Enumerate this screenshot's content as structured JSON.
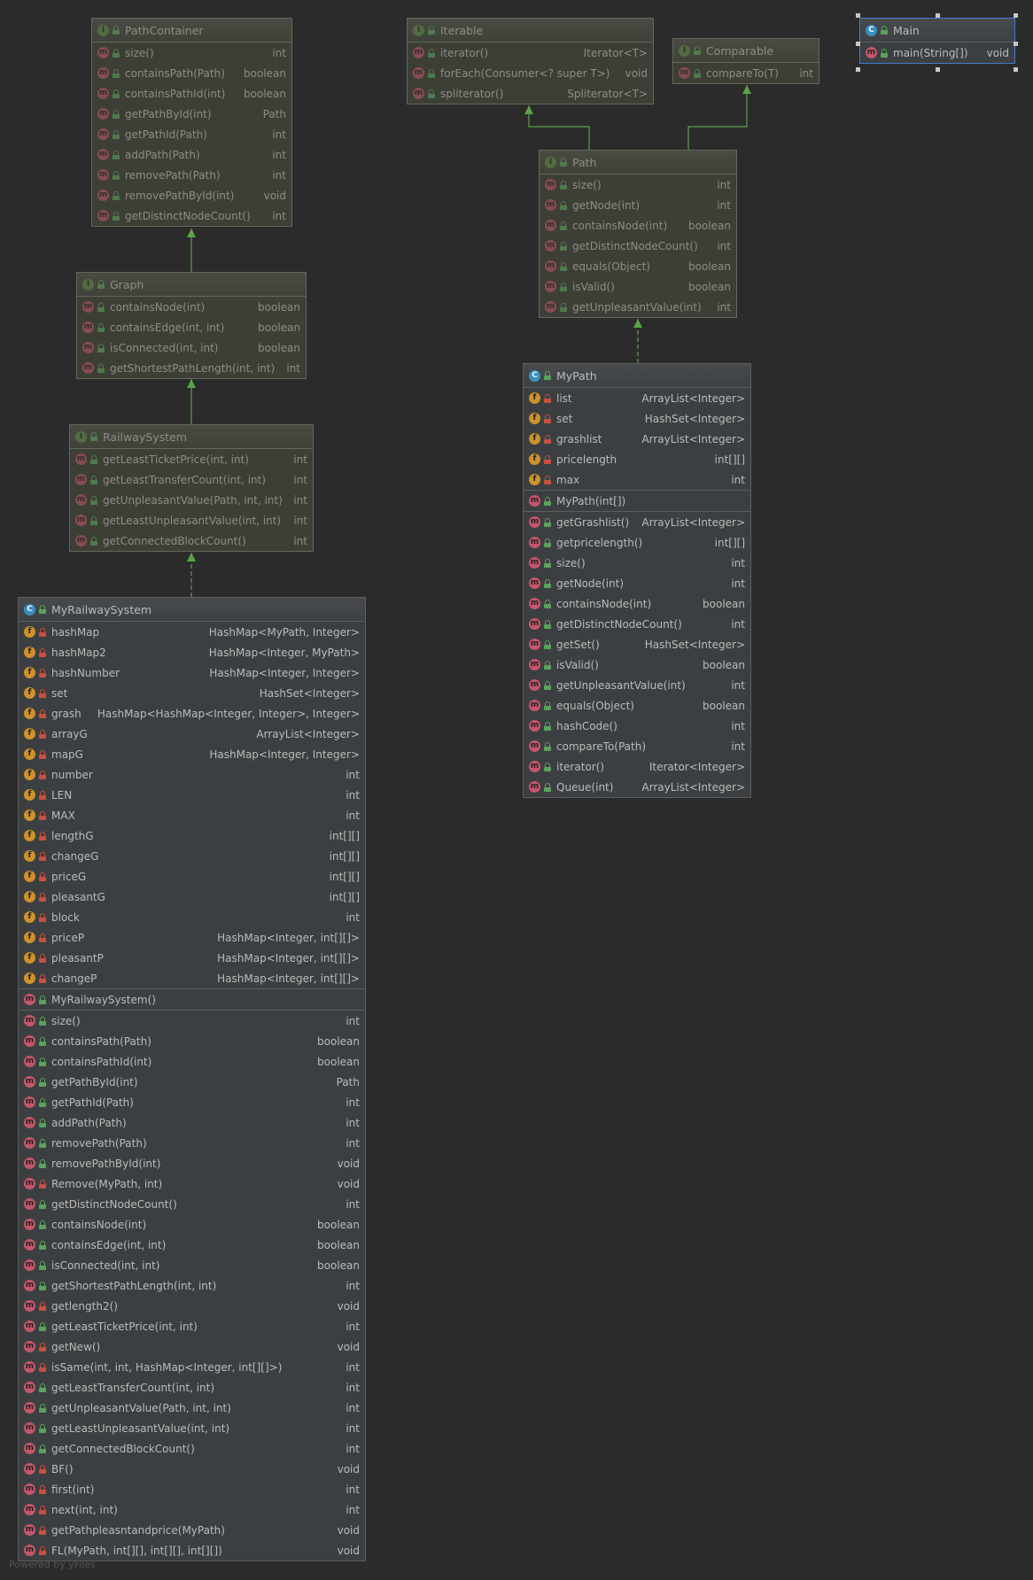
{
  "footer": "Powered by yFiles",
  "boxes": {
    "PathContainer": {
      "title": "PathContainer",
      "icon": "I",
      "methods": [
        {
          "name": "size()",
          "type": "int",
          "vis": "pub"
        },
        {
          "name": "containsPath(Path)",
          "type": "boolean",
          "vis": "pub"
        },
        {
          "name": "containsPathId(int)",
          "type": "boolean",
          "vis": "pub"
        },
        {
          "name": "getPathById(int)",
          "type": "Path",
          "vis": "pub"
        },
        {
          "name": "getPathId(Path)",
          "type": "int",
          "vis": "pub"
        },
        {
          "name": "addPath(Path)",
          "type": "int",
          "vis": "pub"
        },
        {
          "name": "removePath(Path)",
          "type": "int",
          "vis": "pub"
        },
        {
          "name": "removePathById(int)",
          "type": "void",
          "vis": "pub"
        },
        {
          "name": "getDistinctNodeCount()",
          "type": "int",
          "vis": "pub"
        }
      ]
    },
    "Graph": {
      "title": "Graph",
      "icon": "I",
      "methods": [
        {
          "name": "containsNode(int)",
          "type": "boolean",
          "vis": "pub"
        },
        {
          "name": "containsEdge(int, int)",
          "type": "boolean",
          "vis": "pub"
        },
        {
          "name": "isConnected(int, int)",
          "type": "boolean",
          "vis": "pub"
        },
        {
          "name": "getShortestPathLength(int, int)",
          "type": "int",
          "vis": "pub"
        }
      ]
    },
    "RailwaySystem": {
      "title": "RailwaySystem",
      "icon": "I",
      "methods": [
        {
          "name": "getLeastTicketPrice(int, int)",
          "type": "int",
          "vis": "pub"
        },
        {
          "name": "getLeastTransferCount(int, int)",
          "type": "int",
          "vis": "pub"
        },
        {
          "name": "getUnpleasantValue(Path, int, int)",
          "type": "int",
          "vis": "pub"
        },
        {
          "name": "getLeastUnpleasantValue(int, int)",
          "type": "int",
          "vis": "pub"
        },
        {
          "name": "getConnectedBlockCount()",
          "type": "int",
          "vis": "pub"
        }
      ]
    },
    "Iterable": {
      "title": "Iterable",
      "icon": "I",
      "methods": [
        {
          "name": "iterator()",
          "type": "Iterator<T>",
          "vis": "pub"
        },
        {
          "name": "forEach(Consumer<? super T>)",
          "type": "void",
          "vis": "pub"
        },
        {
          "name": "spliterator()",
          "type": "Spliterator<T>",
          "vis": "pub"
        }
      ]
    },
    "Comparable": {
      "title": "Comparable",
      "icon": "I",
      "methods": [
        {
          "name": "compareTo(T)",
          "type": "int",
          "vis": "pub"
        }
      ]
    },
    "Main": {
      "title": "Main",
      "icon": "C",
      "methods": [
        {
          "name": "main(String[])",
          "type": "void",
          "vis": "pub"
        }
      ]
    },
    "Path": {
      "title": "Path",
      "icon": "I",
      "methods": [
        {
          "name": "size()",
          "type": "int",
          "vis": "pub"
        },
        {
          "name": "getNode(int)",
          "type": "int",
          "vis": "pub"
        },
        {
          "name": "containsNode(int)",
          "type": "boolean",
          "vis": "pub"
        },
        {
          "name": "getDistinctNodeCount()",
          "type": "int",
          "vis": "pub"
        },
        {
          "name": "equals(Object)",
          "type": "boolean",
          "vis": "pub"
        },
        {
          "name": "isValid()",
          "type": "boolean",
          "vis": "pub"
        },
        {
          "name": "getUnpleasantValue(int)",
          "type": "int",
          "vis": "pub"
        }
      ]
    },
    "MyPath": {
      "title": "MyPath",
      "icon": "C",
      "fields": [
        {
          "name": "list",
          "type": "ArrayList<Integer>",
          "vis": "priv"
        },
        {
          "name": "set",
          "type": "HashSet<Integer>",
          "vis": "priv"
        },
        {
          "name": "grashlist",
          "type": "ArrayList<Integer>",
          "vis": "priv"
        },
        {
          "name": "pricelength",
          "type": "int[][]",
          "vis": "priv"
        },
        {
          "name": "max",
          "type": "int",
          "vis": "priv"
        }
      ],
      "constructors": [
        {
          "name": "MyPath(int[])",
          "type": "",
          "vis": "pub"
        }
      ],
      "methods": [
        {
          "name": "getGrashlist()",
          "type": "ArrayList<Integer>",
          "vis": "pub"
        },
        {
          "name": "getpricelength()",
          "type": "int[][]",
          "vis": "pub"
        },
        {
          "name": "size()",
          "type": "int",
          "vis": "pub"
        },
        {
          "name": "getNode(int)",
          "type": "int",
          "vis": "pub"
        },
        {
          "name": "containsNode(int)",
          "type": "boolean",
          "vis": "pub"
        },
        {
          "name": "getDistinctNodeCount()",
          "type": "int",
          "vis": "pub"
        },
        {
          "name": "getSet()",
          "type": "HashSet<Integer>",
          "vis": "pub"
        },
        {
          "name": "isValid()",
          "type": "boolean",
          "vis": "pub"
        },
        {
          "name": "getUnpleasantValue(int)",
          "type": "int",
          "vis": "pub"
        },
        {
          "name": "equals(Object)",
          "type": "boolean",
          "vis": "pub"
        },
        {
          "name": "hashCode()",
          "type": "int",
          "vis": "pub"
        },
        {
          "name": "compareTo(Path)",
          "type": "int",
          "vis": "pub"
        },
        {
          "name": "iterator()",
          "type": "Iterator<Integer>",
          "vis": "pub"
        },
        {
          "name": "Queue(int)",
          "type": "ArrayList<Integer>",
          "vis": "pub"
        }
      ]
    },
    "MyRailwaySystem": {
      "title": "MyRailwaySystem",
      "icon": "C",
      "fields": [
        {
          "name": "hashMap",
          "type": "HashMap<MyPath, Integer>",
          "vis": "priv"
        },
        {
          "name": "hashMap2",
          "type": "HashMap<Integer, MyPath>",
          "vis": "priv"
        },
        {
          "name": "hashNumber",
          "type": "HashMap<Integer, Integer>",
          "vis": "priv"
        },
        {
          "name": "set",
          "type": "HashSet<Integer>",
          "vis": "priv"
        },
        {
          "name": "grash",
          "type": "HashMap<HashMap<Integer, Integer>, Integer>",
          "vis": "priv"
        },
        {
          "name": "arrayG",
          "type": "ArrayList<Integer>",
          "vis": "priv"
        },
        {
          "name": "mapG",
          "type": "HashMap<Integer, Integer>",
          "vis": "priv"
        },
        {
          "name": "number",
          "type": "int",
          "vis": "priv"
        },
        {
          "name": "LEN",
          "type": "int",
          "vis": "priv"
        },
        {
          "name": "MAX",
          "type": "int",
          "vis": "priv"
        },
        {
          "name": "lengthG",
          "type": "int[][]",
          "vis": "priv"
        },
        {
          "name": "changeG",
          "type": "int[][]",
          "vis": "priv"
        },
        {
          "name": "priceG",
          "type": "int[][]",
          "vis": "priv"
        },
        {
          "name": "pleasantG",
          "type": "int[][]",
          "vis": "priv"
        },
        {
          "name": "block",
          "type": "int",
          "vis": "priv"
        },
        {
          "name": "priceP",
          "type": "HashMap<Integer, int[][]>",
          "vis": "priv"
        },
        {
          "name": "pleasantP",
          "type": "HashMap<Integer, int[][]>",
          "vis": "priv"
        },
        {
          "name": "changeP",
          "type": "HashMap<Integer, int[][]>",
          "vis": "priv"
        }
      ],
      "constructors": [
        {
          "name": "MyRailwaySystem()",
          "type": "",
          "vis": "pub"
        }
      ],
      "methods": [
        {
          "name": "size()",
          "type": "int",
          "vis": "pub"
        },
        {
          "name": "containsPath(Path)",
          "type": "boolean",
          "vis": "pub"
        },
        {
          "name": "containsPathId(int)",
          "type": "boolean",
          "vis": "pub"
        },
        {
          "name": "getPathById(int)",
          "type": "Path",
          "vis": "pub"
        },
        {
          "name": "getPathId(Path)",
          "type": "int",
          "vis": "pub"
        },
        {
          "name": "addPath(Path)",
          "type": "int",
          "vis": "pub"
        },
        {
          "name": "removePath(Path)",
          "type": "int",
          "vis": "pub"
        },
        {
          "name": "removePathById(int)",
          "type": "void",
          "vis": "pub"
        },
        {
          "name": "Remove(MyPath, int)",
          "type": "void",
          "vis": "priv"
        },
        {
          "name": "getDistinctNodeCount()",
          "type": "int",
          "vis": "pub"
        },
        {
          "name": "containsNode(int)",
          "type": "boolean",
          "vis": "pub"
        },
        {
          "name": "containsEdge(int, int)",
          "type": "boolean",
          "vis": "pub"
        },
        {
          "name": "isConnected(int, int)",
          "type": "boolean",
          "vis": "pub"
        },
        {
          "name": "getShortestPathLength(int, int)",
          "type": "int",
          "vis": "pub"
        },
        {
          "name": "getlength2()",
          "type": "void",
          "vis": "priv"
        },
        {
          "name": "getLeastTicketPrice(int, int)",
          "type": "int",
          "vis": "pub"
        },
        {
          "name": "getNew()",
          "type": "void",
          "vis": "priv"
        },
        {
          "name": "isSame(int, int, HashMap<Integer, int[][]>)",
          "type": "int",
          "vis": "priv"
        },
        {
          "name": "getLeastTransferCount(int, int)",
          "type": "int",
          "vis": "pub"
        },
        {
          "name": "getUnpleasantValue(Path, int, int)",
          "type": "int",
          "vis": "pub"
        },
        {
          "name": "getLeastUnpleasantValue(int, int)",
          "type": "int",
          "vis": "pub"
        },
        {
          "name": "getConnectedBlockCount()",
          "type": "int",
          "vis": "pub"
        },
        {
          "name": "BF()",
          "type": "void",
          "vis": "priv"
        },
        {
          "name": "first(int)",
          "type": "int",
          "vis": "priv"
        },
        {
          "name": "next(int, int)",
          "type": "int",
          "vis": "priv"
        },
        {
          "name": "getPathpleasntandprice(MyPath)",
          "type": "void",
          "vis": "priv"
        },
        {
          "name": "FL(MyPath, int[][], int[][], int[][])",
          "type": "void",
          "vis": "priv"
        }
      ]
    }
  }
}
